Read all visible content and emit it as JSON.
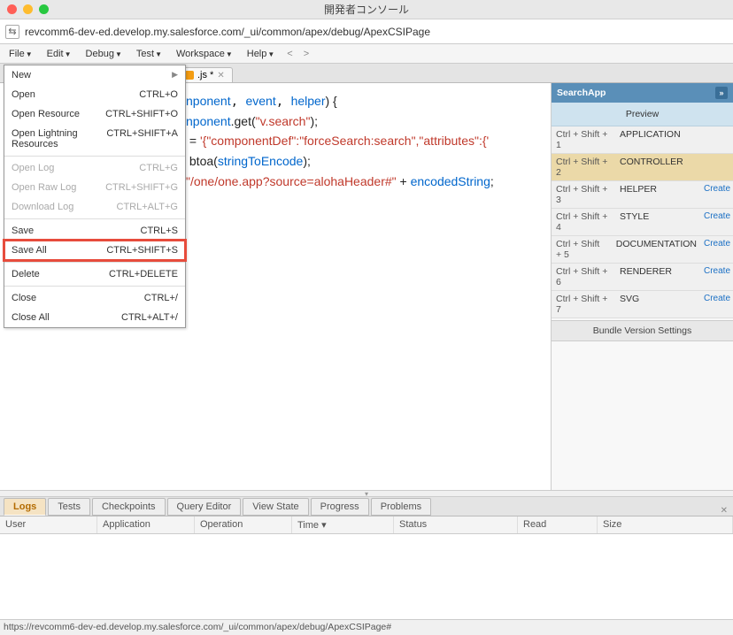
{
  "window": {
    "title": "開発者コンソール"
  },
  "addressbar": {
    "url": "revcomm6-dev-ed.develop.my.salesforce.com/_ui/common/apex/debug/ApexCSIPage"
  },
  "menubar": {
    "items": [
      "File",
      "Edit",
      "Debug",
      "Test",
      "Workspace",
      "Help"
    ]
  },
  "file_menu": {
    "items": [
      {
        "label": "New",
        "shortcut": "",
        "arrow": true
      },
      {
        "label": "Open",
        "shortcut": "CTRL+O"
      },
      {
        "label": "Open Resource",
        "shortcut": "CTRL+SHIFT+O"
      },
      {
        "label": "Open Lightning Resources",
        "shortcut": "CTRL+SHIFT+A"
      },
      {
        "label": "Open Log",
        "shortcut": "CTRL+G",
        "disabled": true
      },
      {
        "label": "Open Raw Log",
        "shortcut": "CTRL+SHIFT+G",
        "disabled": true
      },
      {
        "label": "Download Log",
        "shortcut": "CTRL+ALT+G",
        "disabled": true
      },
      {
        "label": "Save",
        "shortcut": "CTRL+S"
      },
      {
        "label": "Save All",
        "shortcut": "CTRL+SHIFT+S",
        "highlight": true
      },
      {
        "label": "Delete",
        "shortcut": "CTRL+DELETE"
      },
      {
        "label": "Close",
        "shortcut": "CTRL+/"
      },
      {
        "label": "Close All",
        "shortcut": "CTRL+ALT+/"
      }
    ]
  },
  "tab": {
    "name": ".js *"
  },
  "code": {
    "l1a": "nponent",
    "l1b": "event",
    "l1c": "helper",
    "l2a": "nponent",
    "l2b": ".get(",
    "l2c": "\"v.search\"",
    "l2d": ");",
    "l3a": " = ",
    "l3b": "'{\"componentDef\":\"forceSearch:search\",\"attributes\":{'",
    "l4a": " btoa(",
    "l4b": "stringToEncode",
    "l4c": ");",
    "l5a": "\"/one/one.app?source=alohaHeader#\"",
    "l5b": " + ",
    "l5c": "encodedString",
    "l5d": ";",
    "suffix": ") {"
  },
  "sidebar": {
    "title": "SearchApp",
    "preview": "Preview",
    "rows": [
      {
        "k": "Ctrl + Shift + 1",
        "v": "APPLICATION",
        "a": ""
      },
      {
        "k": "Ctrl + Shift + 2",
        "v": "CONTROLLER",
        "a": "",
        "sel": true
      },
      {
        "k": "Ctrl + Shift + 3",
        "v": "HELPER",
        "a": "Create"
      },
      {
        "k": "Ctrl + Shift + 4",
        "v": "STYLE",
        "a": "Create"
      },
      {
        "k": "Ctrl + Shift + 5",
        "v": "DOCUMENTATION",
        "a": "Create"
      },
      {
        "k": "Ctrl + Shift + 6",
        "v": "RENDERER",
        "a": "Create"
      },
      {
        "k": "Ctrl + Shift + 7",
        "v": "SVG",
        "a": "Create"
      }
    ],
    "bundle": "Bundle Version Settings"
  },
  "bottom_tabs": [
    "Logs",
    "Tests",
    "Checkpoints",
    "Query Editor",
    "View State",
    "Progress",
    "Problems"
  ],
  "log_headers": {
    "user": "User",
    "application": "Application",
    "operation": "Operation",
    "time": "Time ▾",
    "status": "Status",
    "read": "Read",
    "size": "Size"
  },
  "statusbar": {
    "text": "https://revcomm6-dev-ed.develop.my.salesforce.com/_ui/common/apex/debug/ApexCSIPage#"
  }
}
